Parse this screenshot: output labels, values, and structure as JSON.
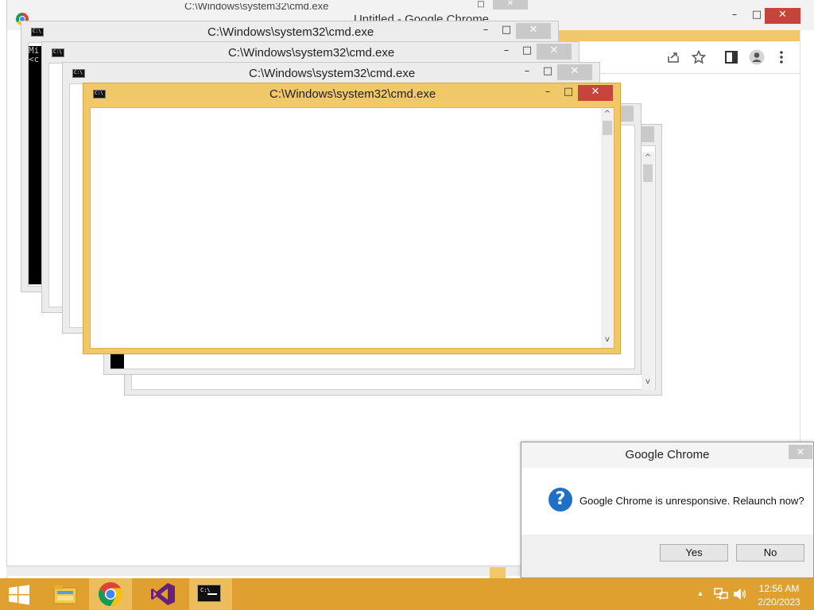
{
  "chrome": {
    "title": "Untitled - Google Chrome",
    "behind_title": "C:\\Windows\\system32\\cmd.exe",
    "controls": {
      "minimize": "–",
      "maximize": "□",
      "close": "✕"
    },
    "toolbar_icons": [
      "share-icon",
      "star-icon",
      "sidepanel-icon",
      "profile-icon",
      "menu-icon"
    ]
  },
  "cmd_windows": [
    {
      "title": "C:\\Windows\\system32\\cmd.exe",
      "console_text": "Mi\n<c"
    },
    {
      "title": "C:\\Windows\\system32\\cmd.exe"
    },
    {
      "title": "C:\\Windows\\system32\\cmd.exe"
    },
    {
      "title": "C:\\Windows\\system32\\cmd.exe"
    }
  ],
  "window_controls": {
    "minimize": "–",
    "maximize": "□",
    "close": "✕",
    "scroll_up": "^",
    "scroll_down": "v"
  },
  "dialog": {
    "title": "Google Chrome",
    "message": "Google Chrome is unresponsive. Relaunch now?",
    "question_glyph": "?",
    "yes_label": "Yes",
    "no_label": "No",
    "close": "✕"
  },
  "taskbar": {
    "time": "12:56 AM",
    "date": "2/20/2023",
    "apps": [
      "start-button",
      "file-explorer",
      "google-chrome",
      "visual-studio",
      "command-prompt"
    ],
    "tray_chevron": "▲"
  },
  "colors": {
    "taskbar": "#e0a02f",
    "active_window_frame": "#f0c868",
    "close_button": "#c7443c",
    "dialog_icon": "#1e6fc6"
  }
}
